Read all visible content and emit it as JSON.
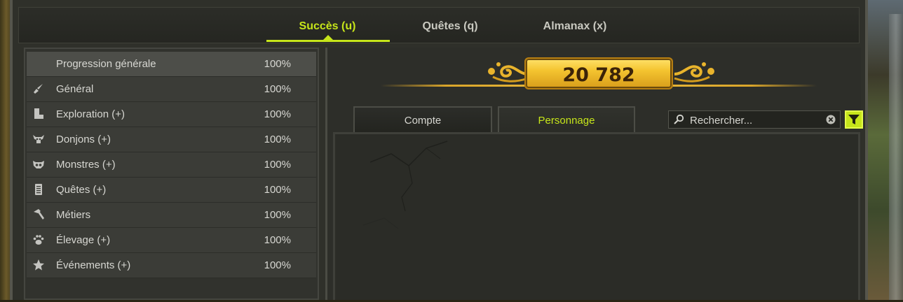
{
  "main_tabs": [
    {
      "label": "Succès (u)",
      "active": true
    },
    {
      "label": "Quêtes (q)",
      "active": false
    },
    {
      "label": "Almanax (x)",
      "active": false
    }
  ],
  "categories": [
    {
      "icon": "progress-icon",
      "label": "Progression générale",
      "percent": "100%",
      "active": true
    },
    {
      "icon": "sword-icon",
      "label": "Général",
      "percent": "100%"
    },
    {
      "icon": "boot-icon",
      "label": "Exploration (+)",
      "percent": "100%"
    },
    {
      "icon": "horned-skull-icon",
      "label": "Donjons (+)",
      "percent": "100%"
    },
    {
      "icon": "monster-mask-icon",
      "label": "Monstres (+)",
      "percent": "100%"
    },
    {
      "icon": "scroll-icon",
      "label": "Quêtes (+)",
      "percent": "100%"
    },
    {
      "icon": "hammer-icon",
      "label": "Métiers",
      "percent": "100%"
    },
    {
      "icon": "paw-icon",
      "label": "Élevage (+)",
      "percent": "100%"
    },
    {
      "icon": "star-icon",
      "label": "Événements (+)",
      "percent": "100%"
    }
  ],
  "score": "20 782",
  "sub_tabs": [
    {
      "label": "Compte",
      "active": false
    },
    {
      "label": "Personnage",
      "active": true
    }
  ],
  "search": {
    "placeholder": "Rechercher..."
  },
  "colors": {
    "accent": "#c6e51a",
    "gold": "#f4c430",
    "panel": "#2d2e29"
  }
}
